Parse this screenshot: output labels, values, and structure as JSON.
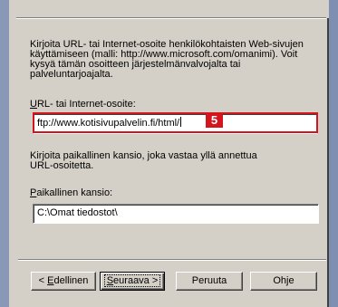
{
  "description_lines": [
    "Kirjoita URL- tai Internet-osoite henkilökohtaisten Web-sivujen",
    "käyttämiseen (malli: http://www.microsoft.com/omanimi). Voit",
    "kysyä tämän osoitteen järjestelmänvalvojalta tai",
    "palveluntarjoajalta."
  ],
  "url": {
    "label_mnemonic": "U",
    "label_rest": "RL- tai Internet-osoite:",
    "value": "ftp://www.kotisivupalvelin.fi/html/",
    "callout_number": "5",
    "highlight_color": "#d3151e"
  },
  "local_description_lines": [
    "Kirjoita paikallinen kansio, joka vastaa yllä annettua",
    "URL-osoitetta."
  ],
  "local": {
    "label_mnemonic": "P",
    "label_rest": "aikallinen kansio:",
    "value": "C:\\Omat tiedostot\\"
  },
  "buttons": {
    "back_prefix": "< ",
    "back_mnemonic": "E",
    "back_rest": "dellinen",
    "next_mnemonic": "S",
    "next_rest": "euraava >",
    "cancel": "Peruuta",
    "help": "Ohje"
  }
}
